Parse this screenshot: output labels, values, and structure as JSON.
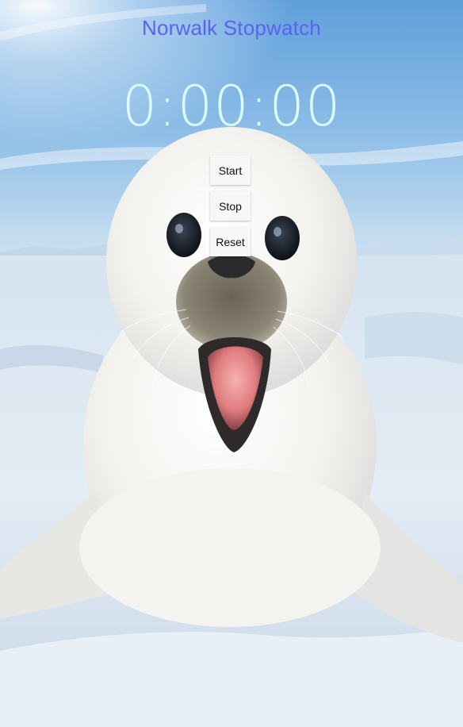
{
  "app": {
    "title": "Norwalk Stopwatch",
    "timer_display": "0:00:00"
  },
  "controls": {
    "start_label": "Start",
    "stop_label": "Stop",
    "reset_label": "Reset"
  },
  "colors": {
    "title": "#5a63f0",
    "timer": "#d8fbff",
    "button_bg": "#f7f7f7"
  }
}
